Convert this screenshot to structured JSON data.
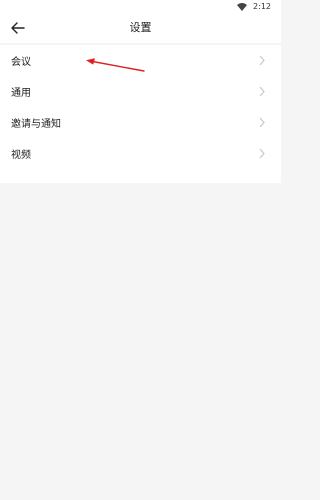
{
  "status_bar": {
    "time": "2:12",
    "wifi_icon": "wifi-icon"
  },
  "header": {
    "title": "设置",
    "back_icon": "back-arrow-icon"
  },
  "settings": {
    "items": [
      {
        "label": "会议"
      },
      {
        "label": "通用"
      },
      {
        "label": "邀请与通知"
      },
      {
        "label": "视频"
      }
    ]
  },
  "colors": {
    "background": "#f5f5f5",
    "surface": "#ffffff",
    "annotation": "#e02020",
    "chevron": "#c8c8c8"
  }
}
